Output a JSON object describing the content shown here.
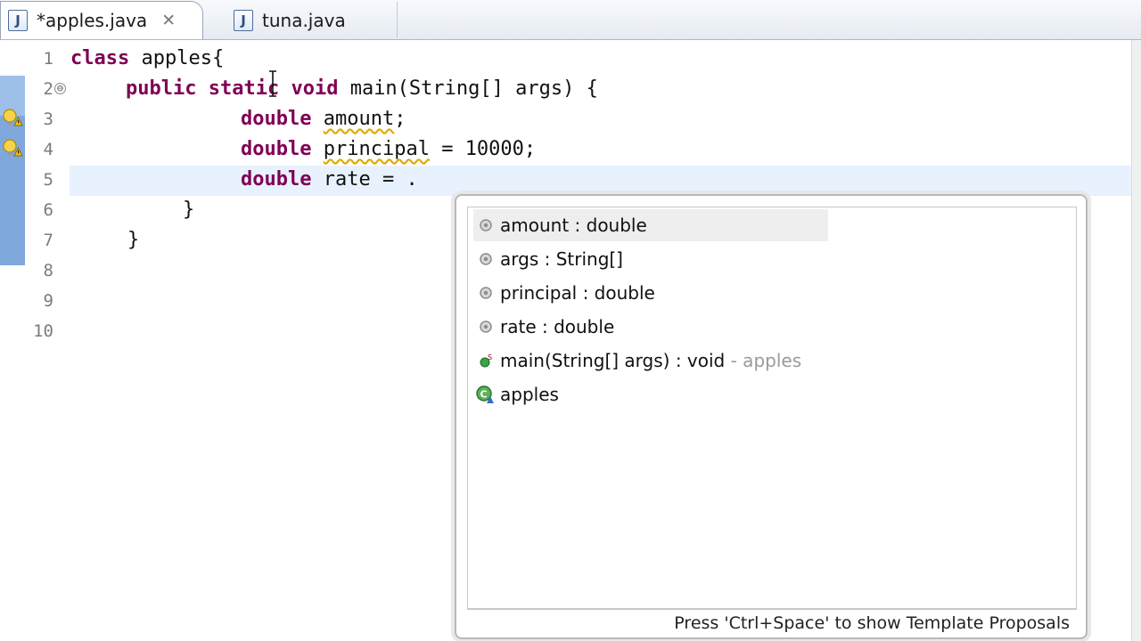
{
  "tabs": [
    {
      "label": "*apples.java",
      "active": true,
      "icon": "java-file-icon",
      "close": "✕"
    },
    {
      "label": "tuna.java",
      "active": false,
      "icon": "java-file-icon"
    }
  ],
  "editor": {
    "line_numbers": [
      "1",
      "2",
      "3",
      "4",
      "5",
      "6",
      "7",
      "8",
      "9",
      "10"
    ],
    "code": {
      "l1_kw": "class",
      "l1_rest": " apples{",
      "l2_kw1": "public",
      "l2_kw2": "static",
      "l2_kw3": "void",
      "l2_rest": " main(String[] args) {",
      "l3_kw": "double",
      "l3_var": "amount",
      "l3_rest": ";",
      "l4_kw": "double",
      "l4_var": "principal",
      "l4_rest": " = 10000;",
      "l5_kw": "double",
      "l5_rest": " rate = .",
      "l6": "}",
      "l7": "}"
    },
    "fold_marker": "⊖"
  },
  "content_assist": {
    "items": [
      {
        "text": "amount : double",
        "icon": "local-variable-icon",
        "selected": true
      },
      {
        "text": "args : String[]",
        "icon": "local-variable-icon"
      },
      {
        "text": "principal : double",
        "icon": "local-variable-icon"
      },
      {
        "text": "rate : double",
        "icon": "local-variable-icon"
      },
      {
        "text": "main(String[] args) : void",
        "qualifier": "- apples",
        "icon": "static-method-icon"
      },
      {
        "text": "apples",
        "icon": "class-icon"
      }
    ],
    "footer": "Press 'Ctrl+Space' to show Template Proposals"
  },
  "colors": {
    "keyword": "#7f0055",
    "selection": "#eeeeee",
    "current_line": "#e8f2fe",
    "gutter_marker": "#7fa8dd"
  }
}
